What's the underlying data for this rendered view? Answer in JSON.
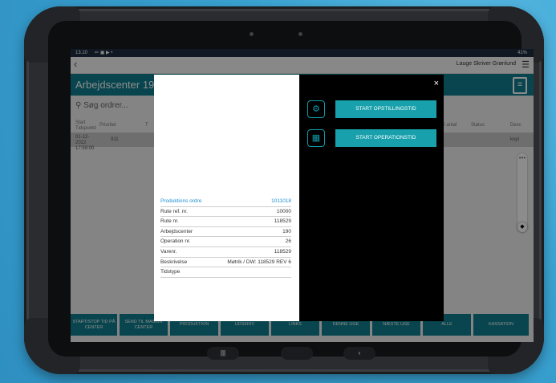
{
  "statusbar": {
    "time": "13.10",
    "icons": "⇐ ▣ ▶ •",
    "battery": "41%"
  },
  "appbar": {
    "back": "‹",
    "user": "Lauge Skriver Grønlund",
    "menu": "☰"
  },
  "titlebar": {
    "title": "Arbejdscenter 190 -"
  },
  "search": {
    "label": "Søg ordrer..."
  },
  "columns": {
    "start": "Start Tidspunkt",
    "prioritet": "Prioritet",
    "t": "T",
    "antal": "al antal",
    "status": "Status",
    "desc": "Desc"
  },
  "row": {
    "date": "01-12-2022 17:59:00",
    "prioritet": "911",
    "desc": "kopi"
  },
  "dialog": {
    "close": "×",
    "start_setup": "START OPSTILLINGSTID",
    "start_operation": "START OPERATIONSTID",
    "rows": [
      {
        "k": "Produktions ordre",
        "v": "1011018"
      },
      {
        "k": "Rute ref. nr.",
        "v": "10000"
      },
      {
        "k": "Rute nr.",
        "v": "118529"
      },
      {
        "k": "Arbejdscenter",
        "v": "190"
      },
      {
        "k": "Operation nr.",
        "v": "26"
      },
      {
        "k": "Varenr.",
        "v": "118529"
      },
      {
        "k": "Beskrivelse",
        "v": "Møtrik / DW: 118529 REV 6"
      },
      {
        "k": "Tidstype",
        "v": ""
      }
    ]
  },
  "bottom": [
    "START/STOP TID PÅ CENTER",
    "SEND TIL MASKIN CENTER",
    "PRODUKTION",
    "UDSKRIV",
    "LINKS",
    "DENNE UGE",
    "NÆSTE UGE",
    "ALLE",
    "KASSATION"
  ],
  "navbar": {
    "recent": "|||",
    "home": "",
    "back": "‹"
  }
}
